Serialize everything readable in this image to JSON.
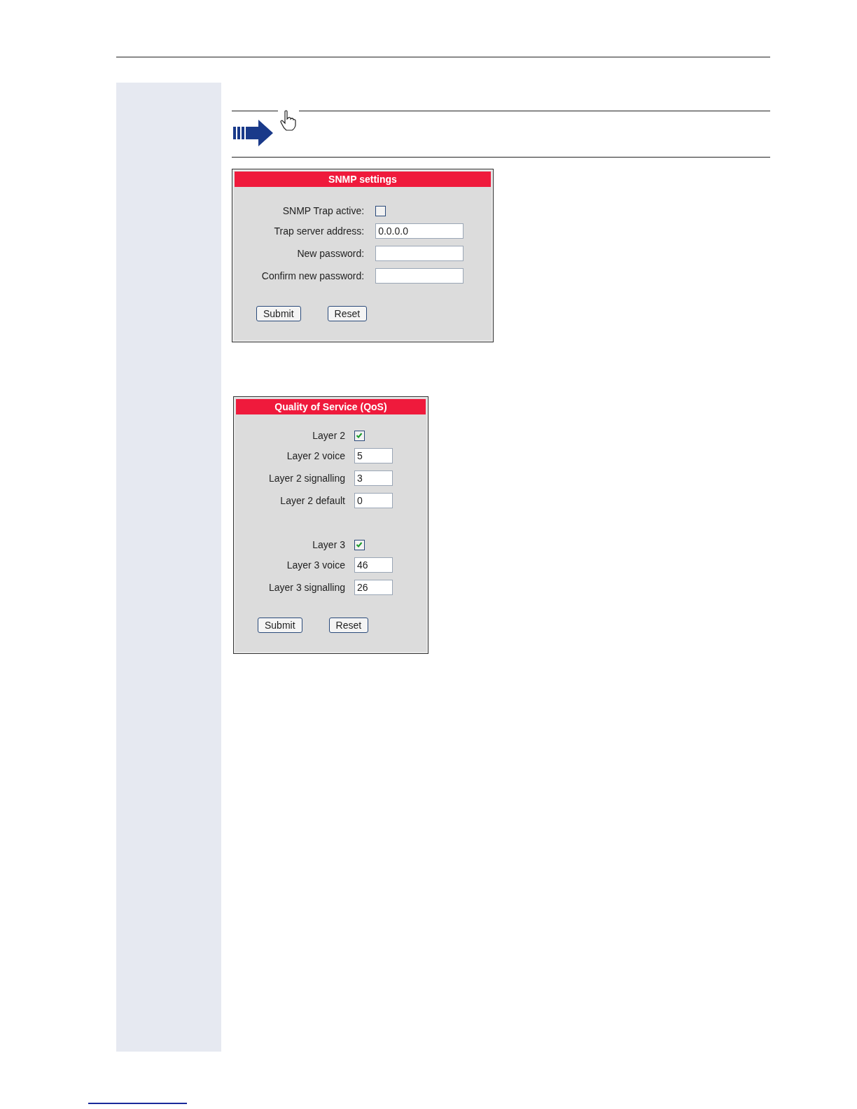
{
  "panels": [
    {
      "title": "SNMP settings",
      "rows": [
        {
          "kind": "checkbox",
          "label": "SNMP Trap active:",
          "checked": false
        },
        {
          "kind": "field",
          "label": "Trap server address:",
          "value": "0.0.0.0"
        },
        {
          "kind": "field",
          "label": "New password:"
        },
        {
          "kind": "field",
          "label": "Confirm new password:"
        }
      ],
      "buttons": [
        "Submit",
        "Reset"
      ]
    },
    {
      "title": "Quality of Service (QoS)",
      "rows": [
        {
          "kind": "checkbox",
          "label": "Layer 2",
          "checked": true
        },
        {
          "kind": "field",
          "label": "Layer 2 voice",
          "value": "5"
        },
        {
          "kind": "field",
          "label": "Layer 2 signalling",
          "value": "3"
        },
        {
          "kind": "field",
          "label": "Layer 2 default",
          "value": "0"
        },
        {
          "kind": "gap"
        },
        {
          "kind": "checkbox",
          "label": "Layer 3",
          "checked": true
        },
        {
          "kind": "field",
          "label": "Layer 3 voice",
          "value": "46"
        },
        {
          "kind": "field",
          "label": "Layer 3 signalling",
          "value": "26"
        }
      ],
      "buttons": [
        "Submit",
        "Reset"
      ]
    }
  ]
}
